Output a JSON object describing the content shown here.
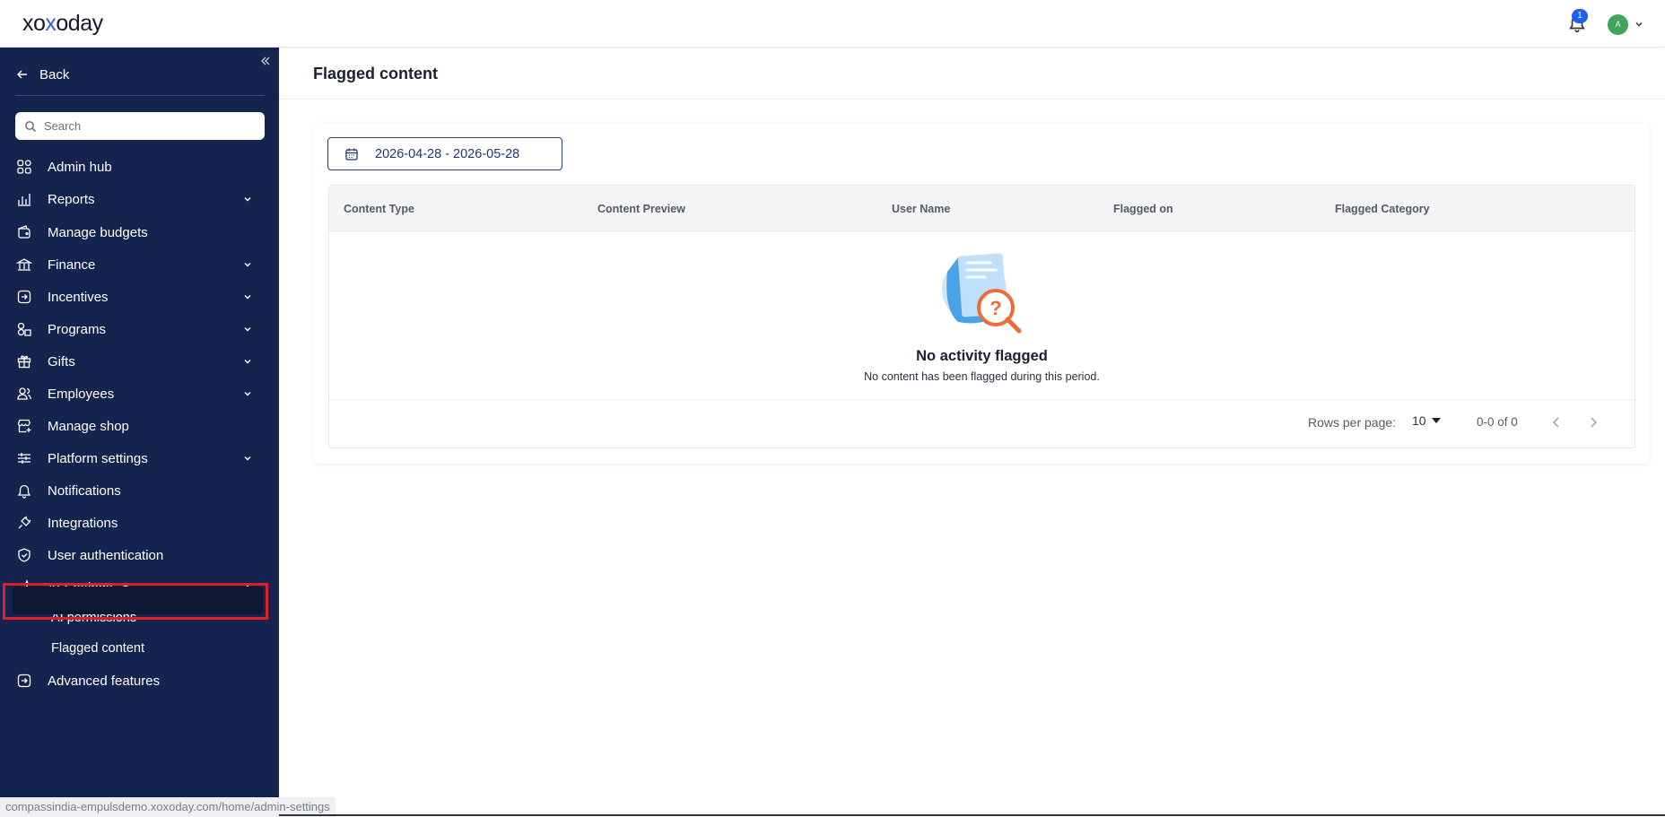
{
  "header": {
    "logo_part1": "xo",
    "logo_x": "x",
    "logo_part2": "oday",
    "notification_count": "1",
    "avatar_initial": "A"
  },
  "sidebar": {
    "back_label": "Back",
    "search_placeholder": "Search",
    "items": [
      {
        "label": "Admin hub",
        "icon": "grid-icon",
        "expandable": false
      },
      {
        "label": "Reports",
        "icon": "bar-chart-icon",
        "expandable": true
      },
      {
        "label": "Manage budgets",
        "icon": "budget-icon",
        "expandable": false
      },
      {
        "label": "Finance",
        "icon": "bank-icon",
        "expandable": true
      },
      {
        "label": "Incentives",
        "icon": "incentive-icon",
        "expandable": true
      },
      {
        "label": "Programs",
        "icon": "programs-icon",
        "expandable": true
      },
      {
        "label": "Gifts",
        "icon": "gift-icon",
        "expandable": true
      },
      {
        "label": "Employees",
        "icon": "users-icon",
        "expandable": true
      },
      {
        "label": "Manage shop",
        "icon": "shop-icon",
        "expandable": false
      },
      {
        "label": "Platform settings",
        "icon": "sliders-icon",
        "expandable": true
      },
      {
        "label": "Notifications",
        "icon": "bell-icon",
        "expandable": false
      },
      {
        "label": "Integrations",
        "icon": "plug-icon",
        "expandable": false
      },
      {
        "label": "User authentication",
        "icon": "shield-icon",
        "expandable": false
      },
      {
        "label": "AI Settings",
        "icon": "sparkle-icon",
        "expandable": true,
        "expanded": true
      }
    ],
    "ai_sub_items": [
      {
        "label": "AI permissions"
      },
      {
        "label": "Flagged content",
        "active": true
      }
    ],
    "advanced_label": "Advanced features"
  },
  "main": {
    "title": "Flagged content",
    "date_range": "2026-04-28 - 2026-05-28",
    "columns": [
      "Content Type",
      "Content Preview",
      "User Name",
      "Flagged on",
      "Flagged Category"
    ],
    "empty_title": "No activity flagged",
    "empty_subtitle": "No content has been flagged during this period.",
    "rows_per_page_label": "Rows per page:",
    "rows_per_page_value": "10",
    "range_text": "0-0 of 0"
  },
  "status_url": "compassindia-empulsdemo.xoxoday.com/home/admin-settings",
  "colors": {
    "sidebar_bg": "#15244f",
    "active_bg": "#0d1632",
    "highlight_red": "#e01e26",
    "badge_blue": "#1e5ef0",
    "avatar_green": "#3fa55a"
  }
}
